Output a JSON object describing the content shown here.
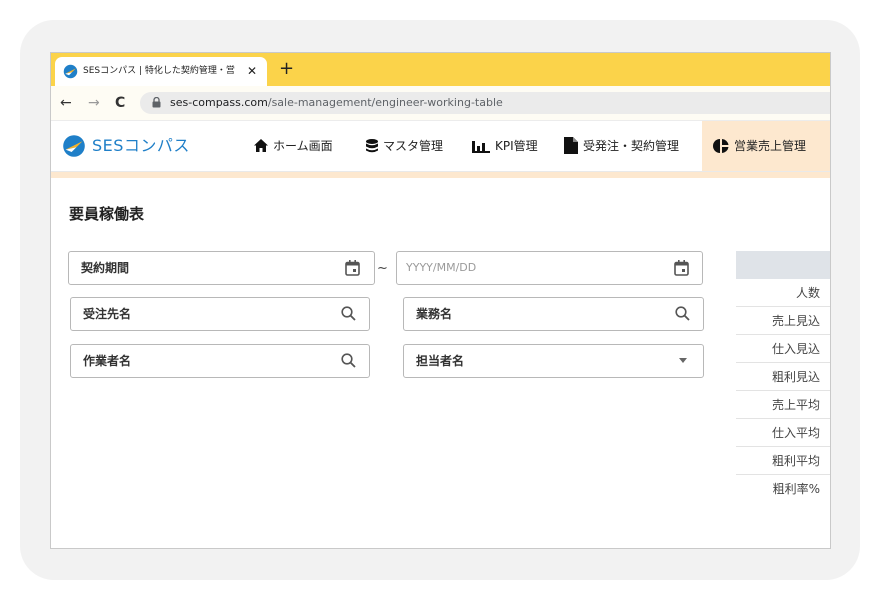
{
  "browser": {
    "tab_title": "SESコンパス | 特化した契約管理・営",
    "tab_close": "✕",
    "new_tab": "+",
    "back": "←",
    "forward": "→",
    "reload": "C",
    "url_domain": "ses-compass.com",
    "url_path": "/sale-management/engineer-working-table",
    "tab_strip_color": "#fbd34a"
  },
  "app": {
    "logo_text": "SESコンパス",
    "brand_color": "#1f7fc8",
    "active_nav_color": "#fde8cf",
    "nav": [
      {
        "label": "ホーム画面",
        "icon": "home-icon"
      },
      {
        "label": "マスタ管理",
        "icon": "database-icon"
      },
      {
        "label": "KPI管理",
        "icon": "bar-chart-icon"
      },
      {
        "label": "受発注・契約管理",
        "icon": "document-icon"
      },
      {
        "label": "営業売上管理",
        "icon": "pie-chart-icon",
        "active": true
      }
    ]
  },
  "page": {
    "title": "要員稼働表",
    "filters": {
      "contract_period_label": "契約期間",
      "range_separator": "~",
      "end_date_placeholder": "YYYY/MM/DD",
      "client_label": "受注先名",
      "business_label": "業務名",
      "worker_label": "作業者名",
      "manager_label": "担当者名"
    },
    "summary_rows": [
      "人数",
      "売上見込",
      "仕入見込",
      "粗利見込",
      "売上平均",
      "仕入平均",
      "粗利平均",
      "粗利率%"
    ]
  }
}
